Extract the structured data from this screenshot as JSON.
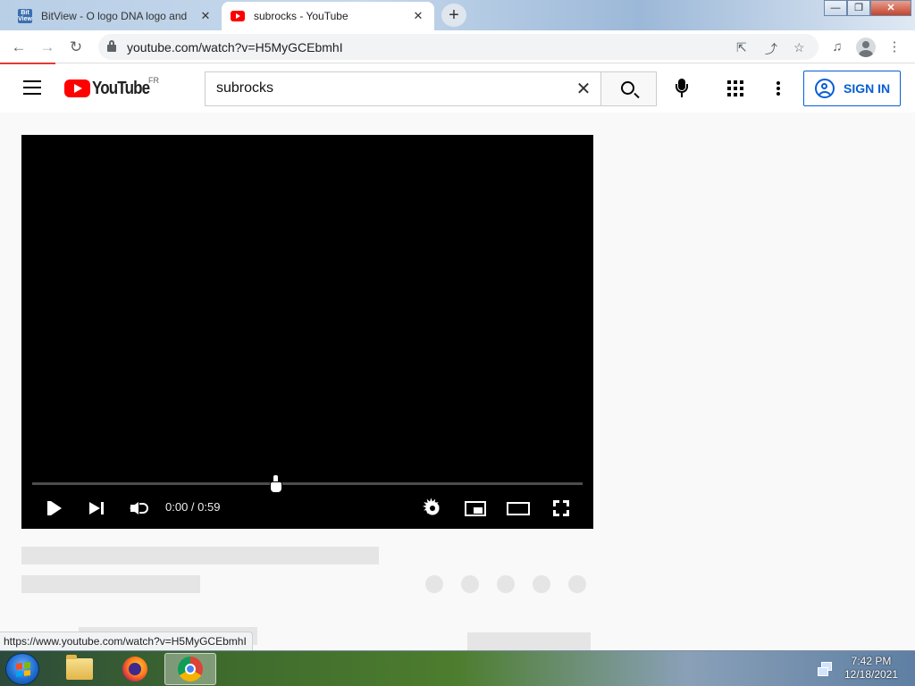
{
  "browser": {
    "tabs": [
      {
        "label": "BitView - O logo DNA logo and",
        "favicon": "bitview-favicon",
        "favicon_text": "Bit\nView",
        "active": false
      },
      {
        "label": "subrocks - YouTube",
        "favicon": "youtube-favicon",
        "active": true
      }
    ],
    "url": "youtube.com/watch?v=H5MyGCEbmhI",
    "window_controls": {
      "minimize": "—",
      "maximize": "❐",
      "close": "✕"
    },
    "status_url": "https://www.youtube.com/watch?v=H5MyGCEbmhI"
  },
  "youtube": {
    "logo_text": "YouTube",
    "country_code": "FR",
    "search": {
      "value": "subrocks",
      "placeholder": "Search"
    },
    "sign_in_label": "SIGN IN",
    "brand_color": "#ff0000",
    "accent_color": "#065fd4"
  },
  "player": {
    "time": "0:00 / 0:59",
    "progress_fraction": 0
  },
  "taskbar": {
    "apps": [
      "windows-explorer",
      "firefox",
      "chrome"
    ],
    "active_app": "chrome",
    "clock_time": "7:42 PM",
    "clock_date": "12/18/2021"
  }
}
